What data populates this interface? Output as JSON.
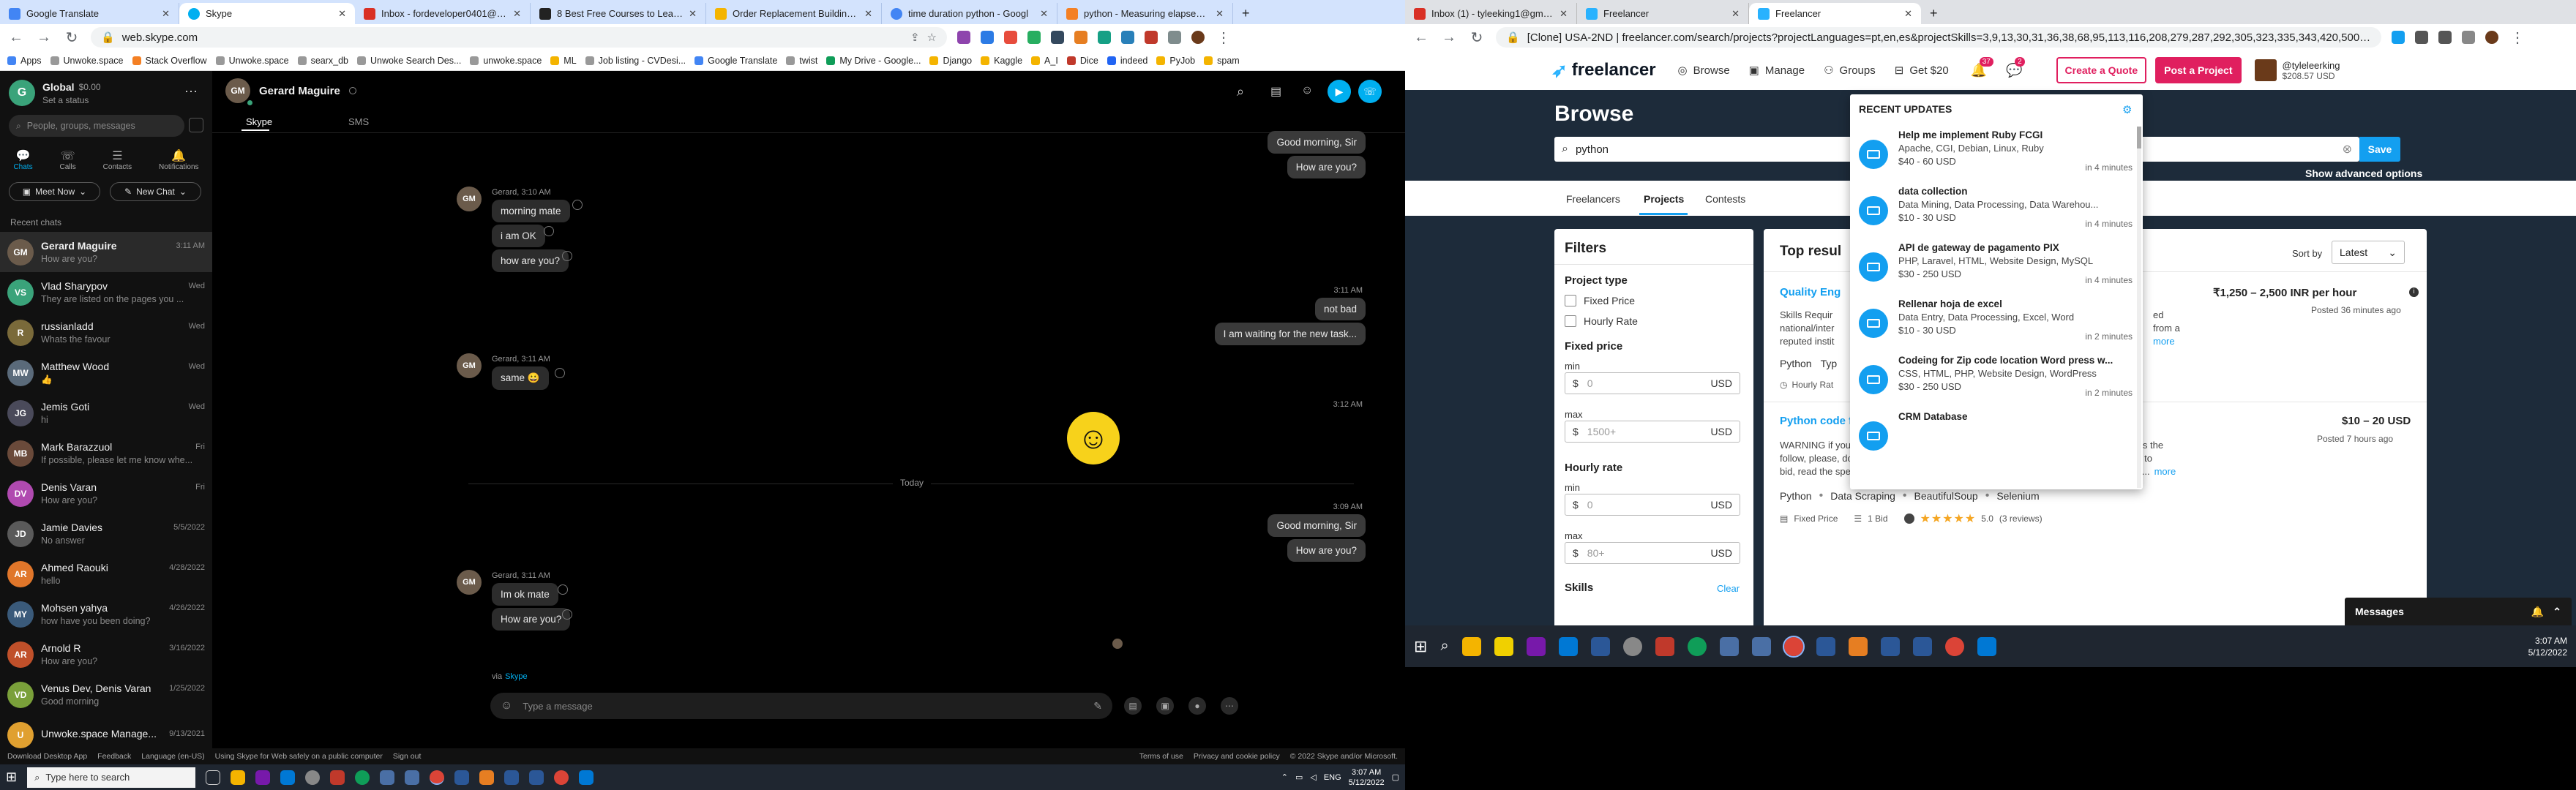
{
  "left_browser": {
    "tabs": [
      {
        "label": "Google Translate",
        "color": "#4285f4"
      },
      {
        "label": "Skype",
        "color": "#00aff0",
        "active": true
      },
      {
        "label": "Inbox - fordeveloper0401@gm",
        "color": "#d93025"
      },
      {
        "label": "8 Best Free Courses to Learn B",
        "color": "#222"
      },
      {
        "label": "Order Replacement Building Re",
        "color": "#f4b400"
      },
      {
        "label": "time duration python - Googl",
        "color": "#4285f4"
      },
      {
        "label": "python - Measuring elapsed tim",
        "color": "#f48024"
      }
    ],
    "url": "web.skype.com",
    "bookmarks": [
      "Apps",
      "Unwoke.space",
      "Stack Overflow",
      "Unwoke.space",
      "searx_db",
      "Unwoke Search Des...",
      "unwoke.space",
      "ML",
      "Job listing - CVDesi...",
      "Google Translate",
      "twist",
      "My Drive - Google...",
      "Django",
      "Kaggle",
      "A_I",
      "Dice",
      "indeed",
      "PyJob",
      "spam"
    ]
  },
  "skype": {
    "profile": {
      "name": "Global",
      "balance": "$0.00",
      "status": "Set a status",
      "initial": "G"
    },
    "search_placeholder": "People, groups, messages",
    "nav": [
      "Chats",
      "Calls",
      "Contacts",
      "Notifications"
    ],
    "meet_now": "Meet Now",
    "new_chat": "New Chat",
    "recent_label": "Recent chats",
    "chats": [
      {
        "name": "Gerard Maguire",
        "preview": "How are you?",
        "time": "3:11 AM",
        "initials": "GM",
        "color": "#6b5b4b"
      },
      {
        "name": "Vlad Sharypov",
        "preview": "They are listed on the pages you ...",
        "time": "Wed",
        "initials": "VS",
        "color": "#3aa37a"
      },
      {
        "name": "russianladd",
        "preview": "Whats the favour",
        "time": "Wed",
        "initials": "R",
        "color": "#7a6a3a"
      },
      {
        "name": "Matthew Wood",
        "preview": "👍",
        "time": "Wed",
        "initials": "MW",
        "color": "#5a6a7a"
      },
      {
        "name": "Jemis Goti",
        "preview": "hi",
        "time": "Wed",
        "initials": "JG",
        "color": "#4a4a5a"
      },
      {
        "name": "Mark Barazzuol",
        "preview": "If possible, please let me know whe...",
        "time": "Fri",
        "initials": "MB",
        "color": "#6a4a3a"
      },
      {
        "name": "Denis Varan",
        "preview": "How are you?",
        "time": "Fri",
        "initials": "DV",
        "color": "#b04ab0"
      },
      {
        "name": "Jamie Davies",
        "preview": "No answer",
        "time": "5/5/2022",
        "initials": "JD",
        "color": "#5a5a5a"
      },
      {
        "name": "Ahmed Raouki",
        "preview": "hello",
        "time": "4/28/2022",
        "initials": "AR",
        "color": "#e0762a"
      },
      {
        "name": "Mohsen yahya",
        "preview": "how have you been doing?",
        "time": "4/26/2022",
        "initials": "MY",
        "color": "#3a5a7a"
      },
      {
        "name": "Arnold R",
        "preview": "How are you?",
        "time": "3/16/2022",
        "initials": "AR",
        "color": "#c0502a"
      },
      {
        "name": "Venus Dev, Denis Varan",
        "preview": "Good morning",
        "time": "1/25/2022",
        "initials": "VD",
        "color": "#7aa03a"
      },
      {
        "name": "Unwoke.space Manage...",
        "preview": "",
        "time": "9/13/2021",
        "initials": "U",
        "color": "#e0a030"
      }
    ],
    "header": {
      "name": "Gerard Maguire",
      "tabs": [
        "Skype",
        "SMS"
      ]
    },
    "messages": {
      "out1": "Good morning, Sir",
      "out2": "How are you?",
      "in_meta1": "Gerard, 3:10 AM",
      "in1": "morning mate",
      "in2": "i am OK",
      "in3": "how are you?",
      "out_time2": "3:11 AM",
      "out3": "not bad",
      "out4": "I am waiting for the new task...",
      "in_meta2": "Gerard, 3:11 AM",
      "in4": "same 😀",
      "out_time3": "3:12 AM",
      "divider": "Today",
      "out_time4": "3:09 AM",
      "out5": "Good morning, Sir",
      "out6": "How are you?",
      "in_meta3": "Gerard, 3:11 AM",
      "in5": "Im ok mate",
      "in6": "How are you?",
      "via": "via",
      "via_link": "Skype"
    },
    "composer_placeholder": "Type a message",
    "footer_left": [
      "Download Desktop App",
      "Feedback",
      "Language (en-US)",
      "Using Skype for Web safely on a public computer",
      "Sign out"
    ],
    "footer_right": [
      "Terms of use",
      "Privacy and cookie policy",
      "© 2022 Skype and/or Microsoft."
    ]
  },
  "left_taskbar": {
    "search_placeholder": "Type here to search",
    "time": "3:07 AM",
    "date": "5/12/2022",
    "lang": "ENG"
  },
  "right_browser": {
    "tabs": [
      {
        "label": "Inbox (1) - tyleeking1@gmail.co",
        "color": "#d93025"
      },
      {
        "label": "Freelancer",
        "color": "#29b2fe"
      },
      {
        "label": "Freelancer",
        "color": "#29b2fe",
        "active": true
      }
    ],
    "url": "[Clone] USA-2ND  |  freelancer.com/search/projects?projectLanguages=pt,en,es&projectSkills=3,9,13,30,31,36,38,68,95,113,116,208,279,287,292,305,323,335,343,420,500,564,586,59..."
  },
  "freelancer": {
    "logo": "freelancer",
    "nav": [
      "Browse",
      "Manage",
      "Groups",
      "Get $20"
    ],
    "badges": [
      "37",
      "2"
    ],
    "create_quote": "Create a Quote",
    "post_project": "Post a Project",
    "username": "@tyleleerking",
    "balance": "$208.57 USD",
    "browse_title": "Browse",
    "search_value": "python",
    "save_label": "Save",
    "advanced": "Show advanced options",
    "subtabs": [
      "Freelancers",
      "Projects",
      "Contests"
    ],
    "filters": {
      "title": "Filters",
      "project_type": "Project type",
      "fixed": "Fixed Price",
      "hourly": "Hourly Rate",
      "fixed_price": "Fixed price",
      "min": "min",
      "max": "max",
      "fp_min": "0",
      "fp_max": "1500+",
      "hourly_rate": "Hourly rate",
      "hr_min": "0",
      "hr_max": "80+",
      "currency": "USD",
      "dollar": "$",
      "skills": "Skills",
      "clear": "Clear"
    },
    "results": {
      "title": "Top resul",
      "sort_label": "Sort by",
      "sort_value": "Latest",
      "r1": {
        "title": "Quality Eng",
        "price": "₹1,250 – 2,500 INR per hour",
        "posted": "Posted 36 minutes ago",
        "line1": "Skills Requir",
        "line1b": "ed",
        "line2": "national/inter",
        "line2b": "from a",
        "line3": "reputed instit",
        "more": "more",
        "tag": "Python",
        "tag2": "Typ",
        "hourly": "Hourly Rat"
      },
      "r2": {
        "title": "Python code for TSE data access",
        "price": "$10 – 20 USD",
        "posted": "Posted 7 hours ago",
        "desc1": "WARNING if you have any proposal that does not comply with the constraints and rules the",
        "desc2": "follow, please, don't waste your time: it will not be accepted. So, before jumping swiftly to",
        "desc3": "bid, read the specs. CONSTRAINTS a) The solution must be developed in Python. No...",
        "more": "more",
        "tags": [
          "Python",
          "Data Scraping",
          "BeautifulSoup",
          "Selenium"
        ],
        "type": "Fixed Price",
        "bids": "1 Bid",
        "rating": "5.0",
        "reviews": "(3 reviews)"
      }
    },
    "updates": {
      "title": "RECENT UPDATES",
      "items": [
        {
          "title": "Help me implement Ruby FCGI",
          "skills": "Apache, CGI, Debian, Linux, Ruby",
          "price": "$40 - 60 USD",
          "when": "in 4 minutes"
        },
        {
          "title": "data collection",
          "skills": "Data Mining, Data Processing, Data Warehou...",
          "price": "$10 - 30 USD",
          "when": "in 4 minutes"
        },
        {
          "title": "API de gateway de pagamento PIX",
          "skills": "PHP, Laravel, HTML, Website Design, MySQL",
          "price": "$30 - 250 USD",
          "when": "in 4 minutes"
        },
        {
          "title": "Rellenar hoja de excel",
          "skills": "Data Entry, Data Processing, Excel, Word",
          "price": "$10 - 30 USD",
          "when": "in 2 minutes"
        },
        {
          "title": "Codeing for Zip code location Word press w...",
          "skills": "CSS, HTML, PHP, Website Design, WordPress",
          "price": "$30 - 250 USD",
          "when": "in 2 minutes"
        },
        {
          "title": "CRM Database",
          "skills": "",
          "price": "",
          "when": ""
        }
      ]
    },
    "messages_label": "Messages"
  },
  "right_taskbar": {
    "time": "3:07 AM",
    "date": "5/12/2022"
  },
  "colors": {
    "skype_blue": "#00aff0",
    "fl_pink": "#e01f5f",
    "fl_blue": "#139ff0",
    "fl_dark": "#1d2b3a"
  }
}
